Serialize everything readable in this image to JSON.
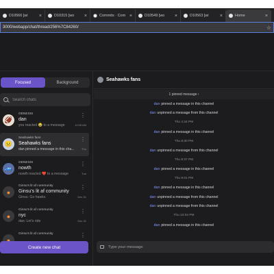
{
  "browser": {
    "tabs": [
      {
        "label": "D10566 [wi",
        "active": false
      },
      {
        "label": "D10315 [wo",
        "active": false
      },
      {
        "label": "Commits · Com",
        "active": false,
        "icon": "github-icon"
      },
      {
        "label": "D10549 [wo",
        "active": false
      },
      {
        "label": "D10563 [wi",
        "active": false
      },
      {
        "label": "Home",
        "active": true
      }
    ],
    "url": "3000/webapp/chat/thread/256%7C84260/"
  },
  "sidebar": {
    "tabs": {
      "focused": "Focused",
      "background": "Background"
    },
    "search_placeholder": "Search chats",
    "chats": [
      {
        "group": "GENESIS",
        "name": "dan",
        "preview": "you reacted 😂 to a message",
        "time": "12:05 AM"
      },
      {
        "group": "Seahawks fans",
        "name": "Seahawks fans",
        "preview": "dan pinned a message in this cha...",
        "time": "Thu",
        "selected": true
      },
      {
        "group": "GENESIS",
        "name": "nowth",
        "preview": "nowth reacted ❤️ to a message",
        "time": "Tue"
      },
      {
        "group": "Ginsu's lit af community",
        "name": "Ginsu's lit af community",
        "preview": "Ginsu: Go hawks",
        "time": "Dec 31"
      },
      {
        "group": "Ginsu's lit af community",
        "name": "nyc",
        "preview": "dan: Let's ride",
        "time": "Dec 31"
      },
      {
        "group": "Ginsu's lit af community",
        "name": "",
        "preview": "",
        "time": ""
      }
    ],
    "create_label": "Create new chat"
  },
  "main": {
    "title": "Seahawks fans",
    "pinned_label": "1 pinned message ›",
    "messages": [
      {
        "who": "dan",
        "text": "pinned a message in this channel"
      },
      {
        "who": "dan",
        "text": "unpinned a message from this channel"
      },
      {
        "ts": "Thu 4:34 PM"
      },
      {
        "who": "dan",
        "text": "pinned a message in this channel"
      },
      {
        "ts": "Thu 8:30 PM"
      },
      {
        "who": "dan",
        "text": "unpinned a message from this channel"
      },
      {
        "ts": "Thu 8:37 PM"
      },
      {
        "who": "dan",
        "text": "pinned a message in this channel"
      },
      {
        "ts": "Thu 9:01 PM"
      },
      {
        "who": "dan",
        "text": "pinned a message in this channel"
      },
      {
        "who": "dan",
        "text": "unpinned a message from this channel"
      },
      {
        "who": "dan",
        "text": "unpinned a message from this channel"
      },
      {
        "ts": "Thu 10:04 PM"
      },
      {
        "who": "dan",
        "text": "pinned a message in this channel"
      }
    ],
    "composer_placeholder": "Type your message"
  },
  "colors": {
    "accent": "#6b53c8",
    "sender": "#7f98ff",
    "background": "#1c1c1e"
  }
}
